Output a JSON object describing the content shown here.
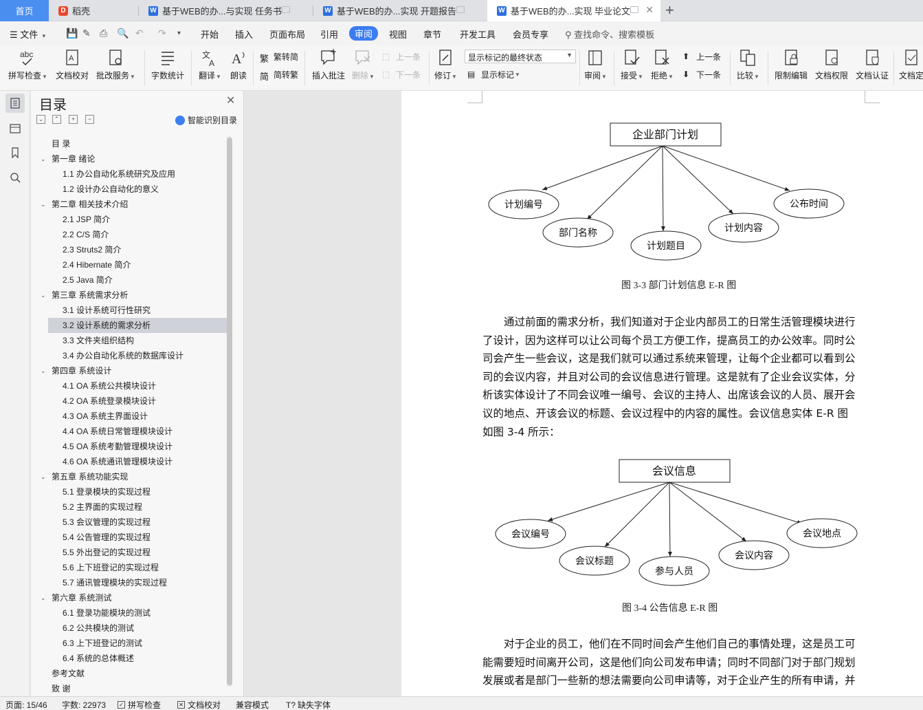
{
  "tabs": [
    {
      "label": "首页"
    },
    {
      "label": "稻壳"
    },
    {
      "label": "基于WEB的办...与实现 任务书"
    },
    {
      "label": "基于WEB的办...实现 开题报告"
    },
    {
      "label": "基于WEB的办...实现 毕业论文"
    }
  ],
  "menu": {
    "file": "文件",
    "items": [
      "开始",
      "插入",
      "页面布局",
      "引用",
      "审阅",
      "视图",
      "章节",
      "开发工具",
      "会员专享"
    ],
    "active": "审阅",
    "search_placeholder": "查找命令、搜索模板"
  },
  "ribbon": {
    "spell_check": "拼写检查",
    "doc_proof": "文档校对",
    "grading": "批改服务",
    "word_count": "字数统计",
    "translate": "翻译",
    "read_aloud": "朗读",
    "to_traditional": "繁转简",
    "to_simplified": "简转繁",
    "insert_comment": "插入批注",
    "delete": "删除",
    "prev_comment": "上一条",
    "next_comment": "下一条",
    "track_changes": "修订",
    "markup_state": "显示标记的最终状态",
    "show_markup": "显示标记",
    "review": "审阅",
    "accept": "接受",
    "reject": "拒绝",
    "prev": "上一条",
    "next": "下一条",
    "compare": "比较",
    "restrict_edit": "限制编辑",
    "doc_permission": "文档权限",
    "doc_certify": "文档认证",
    "doc_final": "文档定"
  },
  "toc": {
    "title": "目录",
    "smart_label": "智能识别目录",
    "items": [
      {
        "text": "目  录",
        "level": 0
      },
      {
        "text": "第一章   绪论",
        "level": 1
      },
      {
        "text": "1.1  办公自动化系统研究及应用",
        "level": 2
      },
      {
        "text": "1.2  设计办公自动化的意义",
        "level": 2
      },
      {
        "text": "第二章   相关技术介绍",
        "level": 1
      },
      {
        "text": "2.1 JSP 简介",
        "level": 2
      },
      {
        "text": "2.2 C/S 简介",
        "level": 2
      },
      {
        "text": "2.3 Struts2 简介",
        "level": 2
      },
      {
        "text": "2.4 Hibernate 简介",
        "level": 2
      },
      {
        "text": "2.5 Java 简介",
        "level": 2
      },
      {
        "text": "第三章   系统需求分析",
        "level": 1
      },
      {
        "text": "3.1  设计系统可行性研究",
        "level": 2
      },
      {
        "text": "3.2  设计系统的需求分析",
        "level": 2,
        "selected": true
      },
      {
        "text": "3.3  文件夹组织结构",
        "level": 2
      },
      {
        "text": "3.4  办公自动化系统的数据库设计",
        "level": 2
      },
      {
        "text": "第四章   系统设计",
        "level": 1
      },
      {
        "text": "4.1 OA 系统公共模块设计",
        "level": 2
      },
      {
        "text": "4.2 OA 系统登录模块设计",
        "level": 2
      },
      {
        "text": "4.3 OA 系统主界面设计",
        "level": 2
      },
      {
        "text": "4.4 OA 系统日常管理模块设计",
        "level": 2
      },
      {
        "text": "4.5 OA 系统考勤管理模块设计",
        "level": 2
      },
      {
        "text": "4.6 OA 系统通讯管理模块设计",
        "level": 2
      },
      {
        "text": "第五章   系统功能实现",
        "level": 1
      },
      {
        "text": "5.1  登录模块的实现过程",
        "level": 2
      },
      {
        "text": "5.2  主界面的实现过程",
        "level": 2
      },
      {
        "text": "5.3  会议管理的实现过程",
        "level": 2
      },
      {
        "text": "5.4  公告管理的实现过程",
        "level": 2
      },
      {
        "text": "5.5  外出登记的实现过程",
        "level": 2
      },
      {
        "text": "5.6  上下班登记的实现过程",
        "level": 2
      },
      {
        "text": "5.7  通讯管理模块的实现过程",
        "level": 2
      },
      {
        "text": "第六章   系统测试",
        "level": 1
      },
      {
        "text": "6.1  登录功能模块的测试",
        "level": 2
      },
      {
        "text": "6.2  公共模块的测试",
        "level": 2
      },
      {
        "text": "6.3  上下班登记的测试",
        "level": 2
      },
      {
        "text": "6.4  系统的总体概述",
        "level": 2
      },
      {
        "text": "参考文献",
        "level": 0
      },
      {
        "text": "致   谢",
        "level": 0
      }
    ]
  },
  "document": {
    "diagram1": {
      "root": "企业部门计划",
      "nodes": [
        "计划编号",
        "部门名称",
        "计划题目",
        "计划内容",
        "公布时间"
      ],
      "caption": "图 3-3   部门计划信息 E-R 图"
    },
    "paragraph1": [
      "通过前面的需求分析，我们知道对于企业内部员工的日常生活管理模块进行",
      "了设计，因为这样可以让公司每个员工方便工作，提高员工的办公效率。同时公",
      "司会产生一些会议，这是我们就可以通过系统来管理，让每个企业都可以看到公",
      "司的会议内容，并且对公司的会议信息进行管理。这是就有了企业会议实体，分",
      "析该实体设计了不同会议唯一编号、会议的主持人、出席该会议的人员、展开会",
      "议的地点、开该会议的标题、会议过程中的内容的属性。会议信息实体 E-R 图",
      "如图  3-4 所示："
    ],
    "diagram2": {
      "root": "会议信息",
      "nodes": [
        "会议编号",
        "会议标题",
        "参与人员",
        "会议内容",
        "会议地点"
      ],
      "caption": "图 3-4   公告信息 E-R 图"
    },
    "paragraph2": [
      "对于企业的员工，他们在不同时间会产生他们自己的事情处理，这是员工可",
      "能需要短时间离开公司，这是他们向公司发布申请；同时不同部门对于部门规划",
      "发展或者是部门一些新的想法需要向公司申请等，对于企业产生的所有申请，并"
    ]
  },
  "status": {
    "page": "页面: 15/46",
    "words": "字数: 22973",
    "spell": "拼写检查",
    "proof": "文档校对",
    "compat": "兼容模式",
    "missing_font": "缺失字体"
  },
  "colors": {
    "accent": "#3b7cf0",
    "home_tab": "#4a8ef0"
  }
}
